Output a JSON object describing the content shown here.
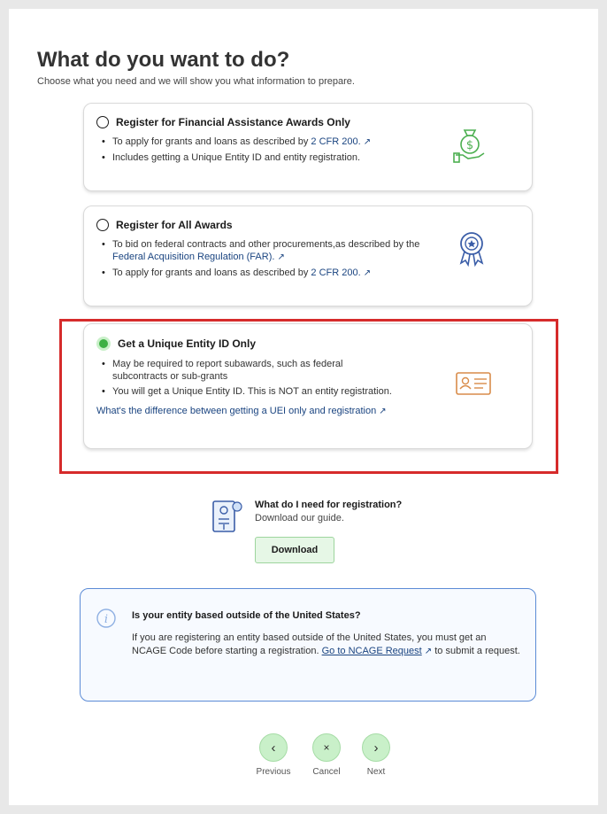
{
  "header": {
    "title": "What do you want to do?",
    "subtitle": "Choose what you need and we will show you what information to prepare."
  },
  "options": [
    {
      "title": "Register for Financial Assistance Awards Only",
      "selected": false,
      "bullet1_pre": "To apply for grants and loans as described by ",
      "bullet1_link": "2 CFR 200.",
      "bullet2": "Includes getting a Unique Entity ID and entity registration.",
      "icon": "money-bag-hand-icon"
    },
    {
      "title": "Register for All Awards",
      "selected": false,
      "bullet1_pre": "To bid on federal contracts and other procurements,as described by the ",
      "bullet1_link": "Federal Acquisition Regulation (FAR).",
      "bullet2_pre": "To apply for grants and loans as described by ",
      "bullet2_link": "2 CFR 200.",
      "icon": "award-ribbon-icon"
    },
    {
      "title": "Get a Unique Entity ID Only",
      "selected": true,
      "bullet1": "May be required to report subawards, such as federal subcontracts or sub-grants",
      "bullet2": "You will get a Unique Entity ID. This is NOT an entity registration.",
      "link": "What's the difference between getting a UEI only and registration",
      "icon": "id-card-icon"
    }
  ],
  "guide": {
    "title": "What do I need for registration?",
    "subtitle": "Download our guide.",
    "button_label": "Download"
  },
  "info": {
    "title": "Is your entity based outside of the United States?",
    "body_pre": "If you are registering an entity based outside of the United States, you must get an NCAGE Code before starting a registration. ",
    "body_link": "Go to NCAGE Request",
    "body_post": " to submit a request."
  },
  "nav": {
    "previous": "Previous",
    "cancel": "Cancel",
    "next": "Next"
  },
  "colors": {
    "accent_green": "#3cb043",
    "link_blue": "#1a4480",
    "highlight_red": "#d62b2b",
    "info_border": "#5b8bd6"
  }
}
